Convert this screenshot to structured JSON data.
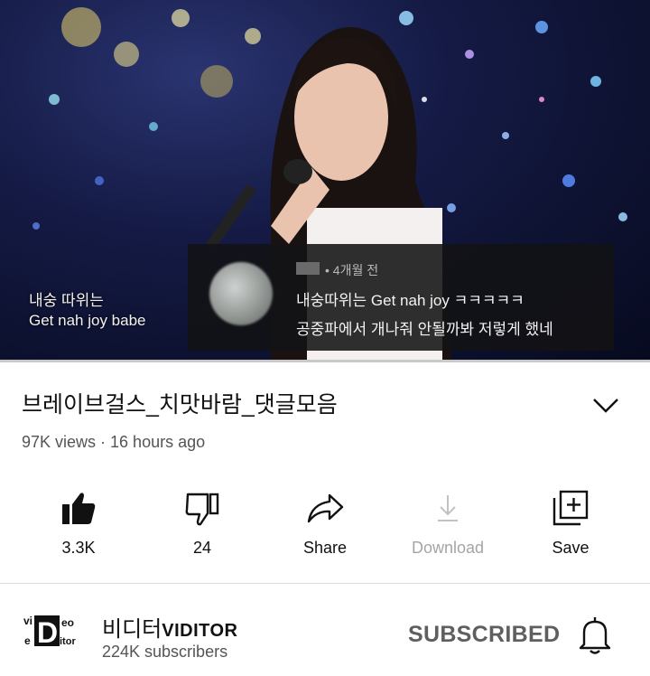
{
  "video": {
    "subtitle_lines": [
      "내숭 따위는",
      "Get nah joy babe"
    ],
    "comment": {
      "meta": "• 4개월 전",
      "line1": "내숭따위는 Get nah joy ㅋㅋㅋㅋㅋ",
      "line2": "공중파에서 개나줘 안될까봐 저렇게 했네"
    }
  },
  "title": "브레이브걸스_치맛바람_댓글모음",
  "stats": "97K views · 16 hours ago",
  "actions": [
    {
      "name": "like",
      "label": "3.3K",
      "icon": "thumbs-up-icon"
    },
    {
      "name": "dislike",
      "label": "24",
      "icon": "thumbs-down-icon"
    },
    {
      "name": "share",
      "label": "Share",
      "icon": "share-icon"
    },
    {
      "name": "download",
      "label": "Download",
      "icon": "download-icon",
      "disabled": true
    },
    {
      "name": "save",
      "label": "Save",
      "icon": "playlist-add-icon"
    }
  ],
  "channel": {
    "name_korean": "비디터",
    "name_latin": "VIDITOR",
    "subscribers": "224K subscribers",
    "subscribe_state": "SUBSCRIBED",
    "logo_text": [
      "vi",
      "D",
      "eo",
      "e",
      "itor"
    ]
  },
  "colors": {
    "text": "#111111",
    "muted": "#555555",
    "disabled": "#a5a5a5",
    "subscribed": "#5f5f5f"
  }
}
